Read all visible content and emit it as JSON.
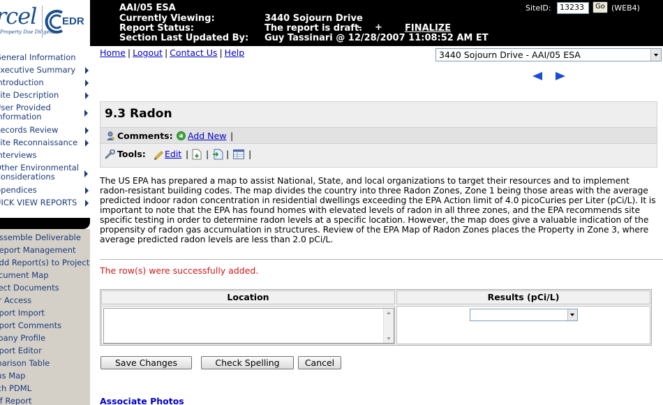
{
  "header": {
    "logo_parcel": "rcel",
    "logo_tagline": "Property Due Diligence",
    "logo_edr": "EDR",
    "report_type": "AAI/05 ESA",
    "currently_viewing_label": "Currently Viewing:",
    "currently_viewing_value": "3440 Sojourn Drive",
    "report_status_label": "Report Status:",
    "report_status_value": "The report is draft.",
    "minus_label": "–",
    "plus_label": "+",
    "finalize_label": "FINALIZE",
    "last_updated_label": "Section Last Updated By:",
    "last_updated_value": "Guy Tassinari @ 12/28/2007 11:08:52 AM ET",
    "siteid_label": "SiteID:",
    "siteid_value": "13233",
    "go_label": "Go",
    "web_label": "(WEB4)"
  },
  "nav_top": [
    {
      "label": "General Information",
      "arrow": false
    },
    {
      "label": "Executive Summary",
      "arrow": true
    },
    {
      "label": "Introduction",
      "arrow": true
    },
    {
      "label": "Site Description",
      "arrow": true
    },
    {
      "label": "User Provided Information",
      "arrow": true
    },
    {
      "label": "Records Review",
      "arrow": true
    },
    {
      "label": "Site Reconnaissance",
      "arrow": true
    },
    {
      "label": "Interviews",
      "arrow": false
    },
    {
      "label": "Other Environmental Considerations",
      "arrow": true
    },
    {
      "label": "Appendices",
      "arrow": true
    },
    {
      "label": "QUICK VIEW REPORTS",
      "arrow": true
    }
  ],
  "nav_bottom": [
    "Assemble Deliverable",
    "Report Management",
    "Add Report(s) to Project",
    "Document Map",
    "Project Documents",
    "User Access",
    "Report Import",
    "Report Comments",
    "Company Profile",
    "Report Editor",
    "Comparison Table",
    "Radius Map",
    "Attach PDML",
    "Staff Report"
  ],
  "links": {
    "home": "Home",
    "logout": "Logout",
    "contact": "Contact Us",
    "help": "Help",
    "separator": "|"
  },
  "report_select": {
    "value": "3440 Sojourn Drive - AAI/05 ESA"
  },
  "section": {
    "title": "9.3 Radon",
    "comments_label": "Comments:",
    "add_new_label": "Add New",
    "tools_label": "Tools:",
    "edit_label": "Edit",
    "separator": "|"
  },
  "body_text": "The US EPA has prepared a map to assist National, State, and local organizations to target their resources and to implement radon-resistant building codes.  The map divides the country into three Radon Zones, Zone 1 being those areas with the average predicted indoor radon concentration in residential dwellings exceeding the EPA Action limit of 4.0 picoCuries per Liter (pCi/L).  It is important to note that the EPA has found homes with elevated levels of radon in all three zones, and the EPA recommends site specific testing in order to determine radon levels at a specific location.  However, the map does give a valuable indication of the propensity of radon gas accumulation in structures.  Review of the EPA Map of Radon Zones places the Property in Zone 3, where average predicted radon levels are less than 2.0 pCi/L.",
  "status_message": "The row(s) were successfully added.",
  "table": {
    "headers": [
      "Location",
      "Results (pCi/L)"
    ],
    "location_value": "",
    "results_value": ""
  },
  "buttons": {
    "save": "Save Changes",
    "spell": "Check Spelling",
    "cancel": "Cancel"
  },
  "associate_photos": "Associate Photos",
  "colors": {
    "header_bg": "#000000",
    "link": "#0000cc",
    "nav_link": "#1b3a7a",
    "success": "#d01a1a",
    "nav_bottom_bg": "#d4d0c8",
    "logo_blue": "#1c4f8c"
  }
}
